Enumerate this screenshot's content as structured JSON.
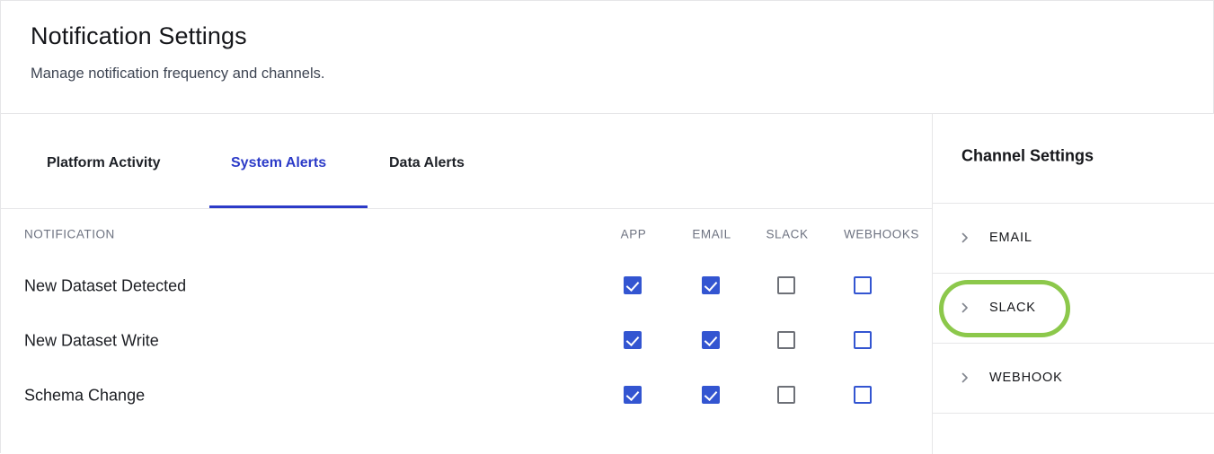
{
  "header": {
    "title": "Notification Settings",
    "subtitle": "Manage notification frequency and channels."
  },
  "tabs": [
    {
      "label": "Platform Activity",
      "active": false
    },
    {
      "label": "System Alerts",
      "active": true
    },
    {
      "label": "Data Alerts",
      "active": false
    }
  ],
  "table": {
    "columns": [
      "NOTIFICATION",
      "APP",
      "EMAIL",
      "SLACK",
      "WEBHOOKS"
    ],
    "rows": [
      {
        "notification": "New Dataset Detected",
        "app": "checked",
        "email": "checked",
        "slack": "unchecked-gray",
        "webhooks": "unchecked-blue"
      },
      {
        "notification": "New Dataset Write",
        "app": "checked",
        "email": "checked",
        "slack": "unchecked-gray",
        "webhooks": "unchecked-blue"
      },
      {
        "notification": "Schema Change",
        "app": "checked",
        "email": "checked",
        "slack": "unchecked-gray",
        "webhooks": "unchecked-blue"
      }
    ]
  },
  "panel": {
    "title": "Channel Settings",
    "items": [
      {
        "label": "EMAIL",
        "icon": "chevron-right-icon",
        "highlighted": false
      },
      {
        "label": "SLACK",
        "icon": "chevron-right-icon",
        "highlighted": true
      },
      {
        "label": "WEBHOOK",
        "icon": "chevron-right-icon",
        "highlighted": false
      }
    ]
  },
  "annotation": {
    "target": "SLACK",
    "shape": "ellipse",
    "color": "#8cc84b"
  },
  "colors": {
    "accent_blue": "#2c3bc8",
    "checkbox_blue": "#3355d1",
    "border_gray": "#e6e6e8",
    "muted_text": "#6d7280",
    "annotation_green": "#8cc84b"
  }
}
